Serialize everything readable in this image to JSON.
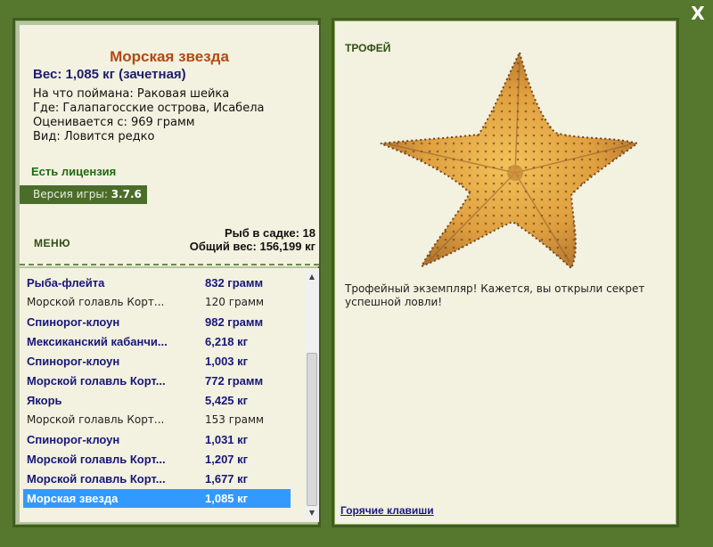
{
  "window": {
    "close_label": "X"
  },
  "catch": {
    "title": "Морская звезда",
    "weight_line": "Вес: 1,085 кг (зачетная)",
    "bait_line": "На что поймана: Раковая шейка",
    "location_line": "Где: Галапагосские острова, Исабела",
    "valued_line": "Оценивается с: 969 грамм",
    "rarity_line": "Вид: Ловится редко"
  },
  "license": {
    "label": "Есть лицензия"
  },
  "version": {
    "label": "Версия игры:",
    "value": "3.7.6"
  },
  "menu": {
    "label": "МЕНЮ"
  },
  "stats": {
    "fish_count": "Рыб в садке: 18",
    "total_weight": "Общий вес: 156,199 кг"
  },
  "fish_list": [
    {
      "name": "Рыба-флейта",
      "weight": "832 грамм",
      "style": "bold"
    },
    {
      "name": "Морской голавль Корт...",
      "weight": "120 грамм",
      "style": "normal"
    },
    {
      "name": "Спинорог-клоун",
      "weight": "982 грамм",
      "style": "bold"
    },
    {
      "name": "Мексиканский кабанчи...",
      "weight": "6,218 кг",
      "style": "bold"
    },
    {
      "name": "Спинорог-клоун",
      "weight": "1,003 кг",
      "style": "bold"
    },
    {
      "name": "Морской голавль Корт...",
      "weight": "772 грамм",
      "style": "bold"
    },
    {
      "name": "Якорь",
      "weight": "5,425 кг",
      "style": "bold"
    },
    {
      "name": "Морской голавль Корт...",
      "weight": "153 грамм",
      "style": "normal"
    },
    {
      "name": "Спинорог-клоун",
      "weight": "1,031 кг",
      "style": "bold"
    },
    {
      "name": "Морской голавль Корт...",
      "weight": "1,207 кг",
      "style": "bold"
    },
    {
      "name": "Морской голавль Корт...",
      "weight": "1,677 кг",
      "style": "bold"
    },
    {
      "name": "Морская звезда",
      "weight": "1,085 кг",
      "style": "selected"
    }
  ],
  "trophy": {
    "label": "ТРОФЕЙ",
    "image": "starfish-trophy-image",
    "text": "Трофейный экземпляр! Кажется, вы открыли секрет успешной ловли!"
  },
  "hotkeys": {
    "label": "Горячие клавиши"
  },
  "colors": {
    "frame_green": "#56782e",
    "panel_bg": "#f3f1df",
    "title_orange": "#b24a12",
    "list_blue": "#17177a",
    "selection_blue": "#3399ff"
  }
}
